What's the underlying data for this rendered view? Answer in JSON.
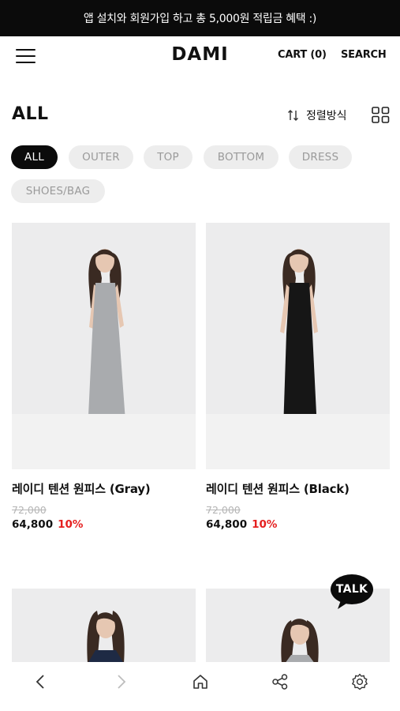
{
  "promo_banner": {
    "text": "앱 설치와 회원가입 하고 총 5,000원 적립금 혜택 :)"
  },
  "header": {
    "logo": "DAMI",
    "cart_label": "CART (0)",
    "search_label": "SEARCH"
  },
  "listing": {
    "title": "ALL",
    "sort_label": "정렬방식"
  },
  "categories": [
    {
      "label": "ALL",
      "active": true
    },
    {
      "label": "OUTER",
      "active": false
    },
    {
      "label": "TOP",
      "active": false
    },
    {
      "label": "BOTTOM",
      "active": false
    },
    {
      "label": "DRESS",
      "active": false
    },
    {
      "label": "SHOES/BAG",
      "active": false
    }
  ],
  "products": [
    {
      "name": "레이디 텐션 원피스 (Gray)",
      "original_price": "72,000",
      "price": "64,800",
      "discount": "10%",
      "dress_color": "#a9abae"
    },
    {
      "name": "레이디 텐션 원피스 (Black)",
      "original_price": "72,000",
      "price": "64,800",
      "discount": "10%",
      "dress_color": "#161616"
    }
  ],
  "chat_bubble": {
    "label": "TALK"
  },
  "colors": {
    "accent_discount": "#e51f1f",
    "banner_bg": "#0b0b0b",
    "chip_bg": "#ededed"
  },
  "bottom_nav": [
    "back-icon",
    "forward-icon",
    "home-icon",
    "share-icon",
    "settings-icon"
  ]
}
